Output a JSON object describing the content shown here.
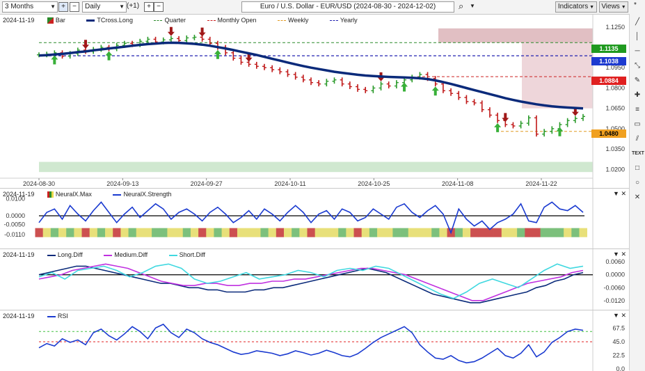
{
  "toolbar": {
    "period": "3 Months",
    "interval": "Daily",
    "offset": "(+1)",
    "symbol": "Euro / U.S. Dollar - EUR/USD (2024-08-30 - 2024-12-02)",
    "indicators": "Indicators",
    "views": "Views"
  },
  "main_panel": {
    "date_label": "2024-11-19",
    "legend": [
      {
        "name": "Bar",
        "color": "#2a8a2a"
      },
      {
        "name": "TCross.Long",
        "color": "#0a2a7a"
      },
      {
        "name": "Quarter",
        "color": "#2a8a2a"
      },
      {
        "name": "Monthly Open",
        "color": "#cc2020"
      },
      {
        "name": "Weekly",
        "color": "#e09a20"
      },
      {
        "name": "Yearly",
        "color": "#2020b0"
      }
    ],
    "price_ticks": [
      "1.1250",
      "1.1100",
      "1.0950",
      "1.0800",
      "1.0650",
      "1.0500",
      "1.0350",
      "1.0200"
    ],
    "date_ticks": [
      "2024-08-30",
      "2024-09-13",
      "2024-09-27",
      "2024-10-11",
      "2024-10-25",
      "2024-11-08",
      "2024-11-22"
    ],
    "price_boxes": [
      {
        "label": "1.1135",
        "bg": "#1f9a1f"
      },
      {
        "label": "1.1038",
        "bg": "#1d3ad0"
      },
      {
        "label": "1.0884",
        "bg": "#e02020"
      },
      {
        "label": "1.0480",
        "bg": "#f0a020"
      }
    ]
  },
  "neural_panel": {
    "date_label": "2024-11-19",
    "legend": [
      "NeuralX.Max",
      "NeuralX.Strength"
    ],
    "ticks": [
      "0.0100",
      "0.0000",
      "-0.0050",
      "-0.0110"
    ]
  },
  "diff_panel": {
    "date_label": "2024-11-19",
    "legend": [
      "Long.Diff",
      "Medium.Diff",
      "Short.Diff"
    ],
    "ticks": [
      "0.0060",
      "0.0000",
      "-0.0060",
      "-0.0120"
    ]
  },
  "rsi_panel": {
    "date_label": "2024-11-19",
    "legend": [
      "RSI"
    ],
    "ticks": [
      "67.5",
      "45.0",
      "22.5",
      "0.0"
    ]
  },
  "chart_data": {
    "type": "ohlc",
    "title": "Euro / U.S. Dollar - EUR/USD (2024-08-30 - 2024-12-02)",
    "ylim": [
      1.015,
      1.128
    ],
    "close": [
      1.1045,
      1.105,
      1.106,
      1.1035,
      1.1055,
      1.108,
      1.107,
      1.1085,
      1.11,
      1.109,
      1.1115,
      1.113,
      1.112,
      1.1145,
      1.116,
      1.114,
      1.1155,
      1.1165,
      1.115,
      1.117,
      1.1175,
      1.116,
      1.113,
      1.11,
      1.106,
      1.102,
      1.099,
      1.0975,
      1.096,
      1.095,
      1.0935,
      1.092,
      1.09,
      1.088,
      1.086,
      1.084,
      1.083,
      1.085,
      1.086,
      1.083,
      1.081,
      1.079,
      1.078,
      1.08,
      1.083,
      1.0815,
      1.084,
      1.086,
      1.088,
      1.09,
      1.087,
      1.083,
      1.078,
      1.076,
      1.073,
      1.07,
      1.069,
      1.064,
      1.06,
      1.056,
      1.053,
      1.052,
      1.054,
      1.058,
      1.046,
      1.048,
      1.05,
      1.053,
      1.056,
      1.0575,
      1.059
    ],
    "tcross_long": [
      1.104,
      1.1042,
      1.1048,
      1.1052,
      1.1058,
      1.1065,
      1.107,
      1.1078,
      1.1085,
      1.1092,
      1.1098,
      1.1105,
      1.1112,
      1.1118,
      1.1124,
      1.1128,
      1.1132,
      1.1134,
      1.1133,
      1.113,
      1.1126,
      1.112,
      1.1112,
      1.1102,
      1.1092,
      1.108,
      1.1068,
      1.1056,
      1.1044,
      1.103,
      1.1016,
      1.1002,
      1.0988,
      1.0975,
      1.0962,
      1.095,
      1.094,
      1.093,
      1.092,
      1.0912,
      1.0905,
      1.0898,
      1.0892,
      1.0888,
      1.0885,
      1.0882,
      1.088,
      1.0878,
      1.0876,
      1.0872,
      1.0866,
      1.0856,
      1.0844,
      1.083,
      1.0815,
      1.08,
      1.0785,
      1.077,
      1.0755,
      1.074,
      1.0725,
      1.0712,
      1.07,
      1.069,
      1.068,
      1.0672,
      1.0665,
      1.066,
      1.0656,
      1.0653,
      1.065
    ],
    "levels": {
      "quarter": 1.1135,
      "yearly": 1.1038,
      "monthly_open": 1.0884,
      "weekly": 1.048
    },
    "neuralx_strength": [
      -0.004,
      0.002,
      0.004,
      -0.002,
      0.006,
      0.001,
      -0.003,
      0.003,
      0.008,
      0.002,
      -0.004,
      0.001,
      0.005,
      -0.001,
      0.003,
      0.007,
      0.004,
      -0.002,
      0.002,
      0.004,
      0.001,
      -0.003,
      0.002,
      0.005,
      0.001,
      -0.004,
      -0.001,
      0.003,
      -0.002,
      0.004,
      0.001,
      -0.003,
      0.002,
      0.006,
      0.002,
      -0.004,
      0.001,
      0.003,
      -0.002,
      0.004,
      0.002,
      -0.003,
      -0.001,
      0.004,
      0.001,
      -0.002,
      0.005,
      0.007,
      0.002,
      -0.001,
      0.003,
      0.006,
      0.001,
      -0.01,
      0.004,
      -0.002,
      -0.006,
      -0.003,
      -0.008,
      -0.004,
      -0.002,
      0.001,
      0.007,
      -0.003,
      -0.004,
      0.005,
      0.008,
      0.004,
      0.003,
      0.006,
      0.002
    ],
    "rsi": [
      35,
      42,
      38,
      50,
      44,
      48,
      40,
      60,
      66,
      55,
      48,
      58,
      70,
      62,
      50,
      68,
      74,
      60,
      52,
      66,
      60,
      50,
      44,
      40,
      34,
      28,
      24,
      26,
      30,
      28,
      26,
      22,
      25,
      30,
      27,
      23,
      26,
      31,
      27,
      22,
      20,
      25,
      34,
      44,
      52,
      58,
      64,
      70,
      60,
      40,
      28,
      18,
      16,
      22,
      14,
      10,
      12,
      18,
      26,
      34,
      22,
      18,
      26,
      40,
      20,
      28,
      44,
      52,
      62,
      66,
      64
    ],
    "long_diff": [
      0.0,
      0.001,
      0.002,
      0.003,
      0.004,
      0.004,
      0.003,
      0.002,
      0.001,
      0.0,
      -0.001,
      -0.002,
      -0.003,
      -0.004,
      -0.004,
      -0.005,
      -0.006,
      -0.006,
      -0.007,
      -0.007,
      -0.008,
      -0.008,
      -0.008,
      -0.007,
      -0.007,
      -0.006,
      -0.006,
      -0.005,
      -0.004,
      -0.003,
      -0.002,
      -0.001,
      0.0,
      0.001,
      0.002,
      0.003,
      0.002,
      0.001,
      -0.001,
      -0.003,
      -0.005,
      -0.007,
      -0.009,
      -0.01,
      -0.011,
      -0.012,
      -0.013,
      -0.013,
      -0.012,
      -0.011,
      -0.01,
      -0.009,
      -0.008,
      -0.006,
      -0.005,
      -0.003,
      -0.002,
      0.0,
      0.001
    ],
    "medium_diff": [
      -0.002,
      -0.001,
      0.0,
      0.002,
      0.003,
      0.004,
      0.005,
      0.004,
      0.003,
      0.001,
      -0.001,
      -0.003,
      -0.004,
      -0.005,
      -0.005,
      -0.004,
      -0.004,
      -0.005,
      -0.005,
      -0.004,
      -0.004,
      -0.003,
      -0.003,
      -0.002,
      -0.002,
      -0.001,
      0.0,
      0.001,
      0.002,
      0.003,
      0.003,
      0.002,
      0.001,
      0.0,
      -0.002,
      -0.004,
      -0.006,
      -0.008,
      -0.01,
      -0.012,
      -0.012,
      -0.01,
      -0.008,
      -0.006,
      -0.004,
      -0.003,
      -0.002,
      -0.001,
      0.001,
      0.002
    ],
    "short_diff": [
      -0.001,
      0.001,
      -0.002,
      0.002,
      0.003,
      0.004,
      0.002,
      -0.001,
      0.001,
      0.004,
      0.005,
      0.003,
      -0.002,
      -0.004,
      -0.003,
      -0.001,
      0.001,
      -0.002,
      -0.001,
      0.0,
      0.002,
      0.001,
      -0.001,
      0.002,
      0.003,
      0.002,
      0.004,
      0.003,
      0.0,
      -0.003,
      -0.006,
      -0.009,
      -0.011,
      -0.008,
      -0.004,
      -0.002,
      -0.004,
      -0.006,
      -0.002,
      0.002,
      0.005,
      0.003,
      0.004
    ]
  }
}
